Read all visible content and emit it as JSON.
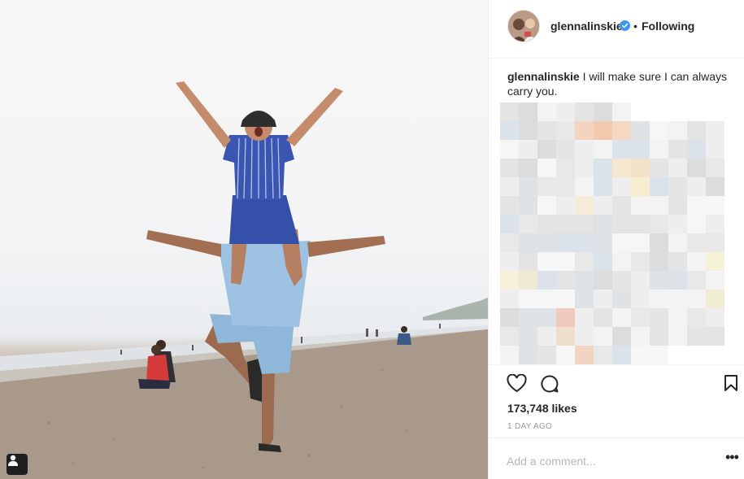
{
  "post": {
    "username": "glennalinskie",
    "separator": "•",
    "follow_status": "Following",
    "caption_user": "glennalinskie",
    "caption_text": "I will make sure I can always carry you.",
    "likes": "173,748 likes",
    "time_ago": "1 DAY AGO",
    "comment_placeholder": "Add a comment...",
    "more_label": "•••"
  },
  "icons": {
    "verified": "verified-badge-icon",
    "like": "heart-icon",
    "comment": "speech-bubble-icon",
    "save": "bookmark-icon",
    "tagged": "person-tag-icon"
  },
  "colors": {
    "verified_blue": "#3897f0",
    "text": "#262626",
    "muted": "#999999",
    "border": "#efefef"
  }
}
